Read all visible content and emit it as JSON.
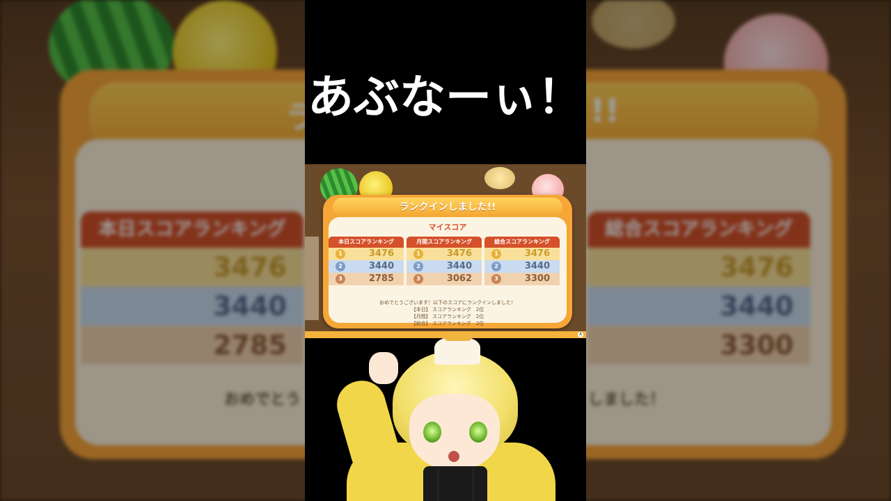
{
  "caption": "あぶなーぃ！",
  "background": {
    "title_left": "ラ",
    "title_right": "!!",
    "columns": [
      {
        "title": "本日スコアランキング",
        "scores": [
          "3476",
          "3440",
          "2785"
        ]
      },
      {
        "title": "総合スコアランキング",
        "scores": [
          "3476",
          "3440",
          "3300"
        ]
      }
    ],
    "msg_left": "おめでとう",
    "msg_right": "しました！"
  },
  "dialog": {
    "header": "ランクインしました!!",
    "my_score_label": "マイスコア",
    "columns": [
      {
        "title": "本日スコアランキング",
        "ranks": [
          "1",
          "2",
          "3"
        ],
        "scores": [
          "3476",
          "3440",
          "2785"
        ]
      },
      {
        "title": "月間スコアランキング",
        "ranks": [
          "1",
          "2",
          "3"
        ],
        "scores": [
          "3476",
          "3440",
          "3062"
        ]
      },
      {
        "title": "総合スコアランキング",
        "ranks": [
          "1",
          "2",
          "3"
        ],
        "scores": [
          "3476",
          "3440",
          "3300"
        ]
      }
    ],
    "congrats": "おめでとうございます！以下のスコアにランクインしました！",
    "results": [
      "【本日】 スコアランキング　2位",
      "【月間】 スコアランキング　2位",
      "【総合】 スコアランキング　2位"
    ],
    "corner_button": "A"
  },
  "colors": {
    "panel_orange": "#f6a637",
    "header_red": "#d4512a",
    "gold_row": "#f9e09a",
    "silver_row": "#c9dbf0",
    "bronze_row": "#f1d2b0"
  }
}
